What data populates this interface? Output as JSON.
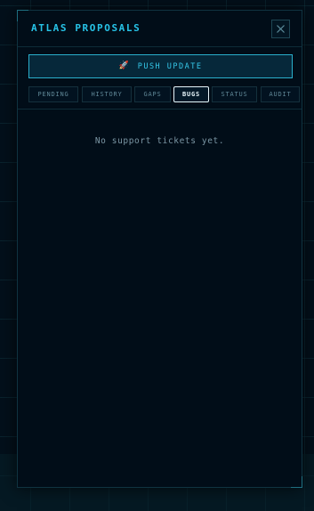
{
  "panel": {
    "title": "ATLAS PROPOSALS",
    "close_icon": "close-icon"
  },
  "push_button": {
    "icon": "rocket-icon",
    "icon_glyph": "🚀",
    "label": "PUSH UPDATE"
  },
  "tabs": [
    {
      "label": "PENDING",
      "active": false
    },
    {
      "label": "HISTORY",
      "active": false
    },
    {
      "label": "GAPS",
      "active": false
    },
    {
      "label": "BUGS",
      "active": true
    },
    {
      "label": "STATUS",
      "active": false
    },
    {
      "label": "AUDIT",
      "active": false
    }
  ],
  "content": {
    "empty_message": "No support tickets yet."
  },
  "colors": {
    "accent": "#27c4e8",
    "panel_bg": "#010d18",
    "active_tab_border": "#e8f6fb"
  }
}
